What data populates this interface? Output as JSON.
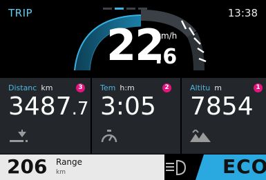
{
  "header": {
    "mode": "TRIP",
    "clock": "13:38"
  },
  "page_indicator": {
    "count": 4,
    "active_index": 1
  },
  "speed": {
    "integer": "22",
    "decimal": ".6",
    "unit": "km/h"
  },
  "tiles": [
    {
      "label": "Distanc",
      "unit": "km",
      "badge": "3",
      "value_main": "3487",
      "value_small": ".7",
      "icon": "road-distance-icon"
    },
    {
      "label": "Tem",
      "unit": "h:m",
      "badge": "2",
      "value_main": "3:05",
      "value_small": "",
      "icon": "stopwatch-icon"
    },
    {
      "label": "Altitu",
      "unit": "m",
      "badge": "1",
      "value_main": "7854",
      "value_small": "",
      "icon": "mountain-icon"
    }
  ],
  "range": {
    "value": "206",
    "label": "Range",
    "unit": "km"
  },
  "headlight": {
    "icon": "low-beam-headlight-icon"
  },
  "ride_mode": {
    "label": "ECO"
  },
  "colors": {
    "accent": "#39b6e8",
    "badge": "#e6157e",
    "tile_bg": "#23272b",
    "eco_bg": "#2aa8e0"
  }
}
